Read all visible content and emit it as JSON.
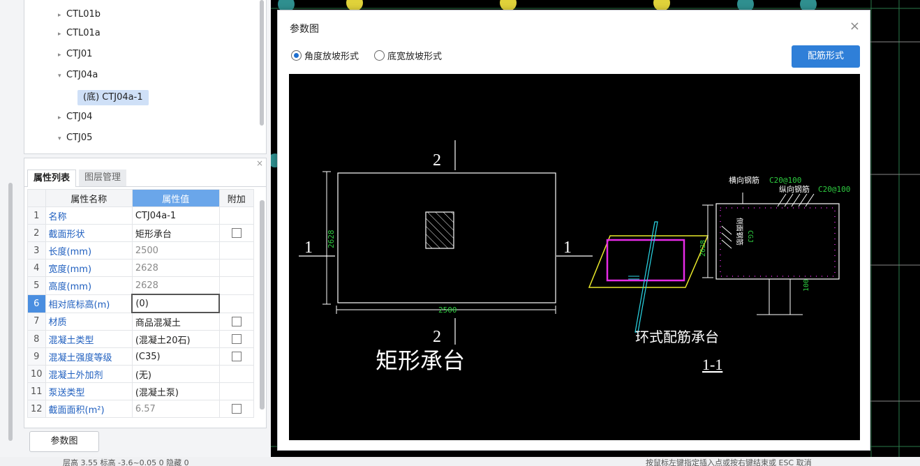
{
  "tree": {
    "items": [
      {
        "label": "CTL01b",
        "arrow": "▸"
      },
      {
        "label": "CTL01a",
        "arrow": "▸"
      },
      {
        "label": "CTJ01",
        "arrow": "▸"
      },
      {
        "label": "CTJ04a",
        "arrow": "▾"
      },
      {
        "label": "(底) CTJ04a-1",
        "arrow": ""
      },
      {
        "label": "CTJ04",
        "arrow": "▸"
      },
      {
        "label": "CTJ05",
        "arrow": "▾"
      }
    ]
  },
  "props": {
    "tabs": [
      "属性列表",
      "图层管理"
    ],
    "close": "×",
    "headers": {
      "name": "属性名称",
      "value": "属性值",
      "extra": "附加"
    },
    "rows": [
      {
        "n": "1",
        "name": "名称",
        "value": "CTJ04a-1"
      },
      {
        "n": "2",
        "name": "截面形状",
        "value": "矩形承台"
      },
      {
        "n": "3",
        "name": "长度(mm)",
        "value": "2500"
      },
      {
        "n": "4",
        "name": "宽度(mm)",
        "value": "2628"
      },
      {
        "n": "5",
        "name": "高度(mm)",
        "value": "2628"
      },
      {
        "n": "6",
        "name": "相对底标高(m)",
        "value": "(0)"
      },
      {
        "n": "7",
        "name": "材质",
        "value": "商品混凝土"
      },
      {
        "n": "8",
        "name": "混凝土类型",
        "value": "(混凝土20石)"
      },
      {
        "n": "9",
        "name": "混凝土强度等级",
        "value": "(C35)"
      },
      {
        "n": "10",
        "name": "混凝土外加剂",
        "value": "(无)"
      },
      {
        "n": "11",
        "name": "泵送类型",
        "value": "(混凝土泵)"
      },
      {
        "n": "12",
        "name": "截面面积(m²)",
        "value": "6.57"
      }
    ]
  },
  "param_button": "参数图",
  "dialog": {
    "title": "参数图",
    "close": "×",
    "radio_slope_angle": "角度放坡形式",
    "radio_slope_width": "底宽放坡形式",
    "rebar_button": "配筋形式",
    "drawing": {
      "plan_title": "矩形承台",
      "section_title": "环式配筋承台",
      "section_mark": "1-1",
      "mark_1": "1",
      "mark_2": "2",
      "dim_length": "2500",
      "dim_width": "2628",
      "dim_section_height": "2628",
      "dim_cover": "100",
      "transverse_label": "横向钢筋",
      "transverse_value": "C20@100",
      "longitudinal_label": "纵向钢筋",
      "longitudinal_value": "C20@100",
      "side_label": "侧面钢筋",
      "cgj_label": "CGJ"
    }
  },
  "status_text": "层高 3.55 标高 -3.6~0.05 0 隐藏 0",
  "status_hint": "按鼠标左键指定插入点或按右键结束或 ESC 取消",
  "colors": {
    "accent": "#2f7fd8",
    "header_value": "#6aa6ea",
    "row_highlight": "#4a8ee0"
  }
}
